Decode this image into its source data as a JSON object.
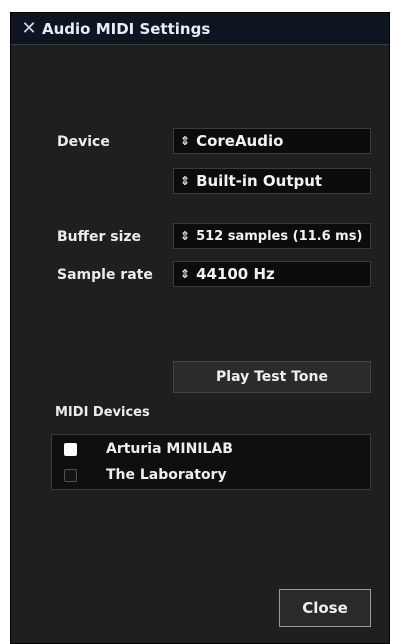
{
  "window": {
    "title": "Audio MIDI Settings",
    "close_icon": "close-x-icon"
  },
  "device": {
    "label": "Device",
    "type_value": "CoreAudio",
    "output_value": "Built-in Output"
  },
  "buffer": {
    "label": "Buffer size",
    "value": "512 samples (11.6 ms)"
  },
  "sample_rate": {
    "label": "Sample rate",
    "value": "44100 Hz"
  },
  "combo_arrow_glyph": "⇕",
  "play_test_tone_label": "Play Test Tone",
  "midi": {
    "label": "MIDI Devices",
    "devices": [
      {
        "name": "Arturia MINILAB",
        "enabled": true
      },
      {
        "name": "The Laboratory",
        "enabled": false
      }
    ]
  },
  "close_button_label": "Close",
  "colors": {
    "window_bg": "#1f1f1f",
    "titlebar_bg": "#0f1520",
    "field_bg": "#0c0c0c",
    "text": "#ececec"
  }
}
